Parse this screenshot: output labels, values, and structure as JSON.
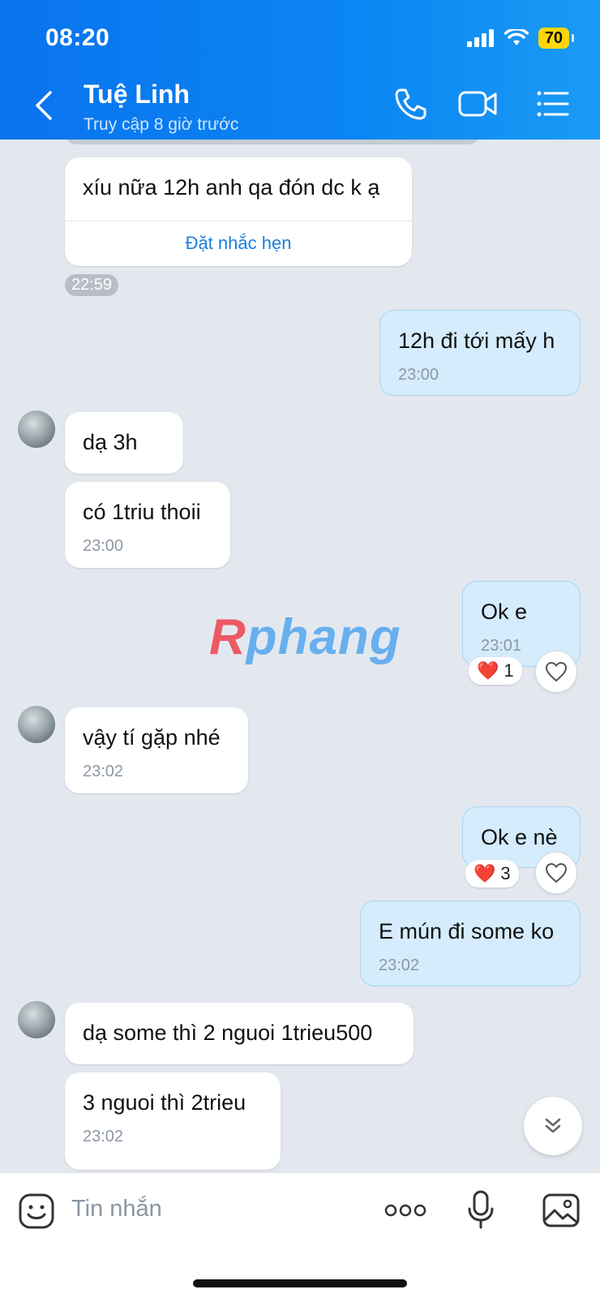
{
  "status_bar": {
    "time": "08:20",
    "battery": "70"
  },
  "header": {
    "contact_name": "Tuệ Linh",
    "contact_status": "Truy cập 8 giờ trước",
    "icons": [
      "back-icon",
      "phone-icon",
      "video-call-icon",
      "menu-icon"
    ]
  },
  "messages": [
    {
      "side": "in",
      "text": "xíu nữa 12h anh qa đón dc k ạ",
      "action": "Đặt nhắc hẹn",
      "time": "22:59"
    },
    {
      "side": "out",
      "text": "12h đi tới mấy h",
      "time": "23:00"
    },
    {
      "side": "in",
      "text": "dạ 3h"
    },
    {
      "side": "in",
      "text": "có 1triu thoii",
      "time": "23:00"
    },
    {
      "side": "out",
      "text": "Ok e",
      "time": "23:01",
      "reaction": {
        "emoji": "❤️",
        "count": "1"
      }
    },
    {
      "side": "in",
      "text": "vậy tí gặp nhé",
      "time": "23:02"
    },
    {
      "side": "out",
      "text": "Ok e nè",
      "reaction": {
        "emoji": "❤️",
        "count": "3"
      }
    },
    {
      "side": "out",
      "text": "E mún đi some ko",
      "time": "23:02"
    },
    {
      "side": "in",
      "text": "dạ some thì 2 nguoi 1trieu500"
    },
    {
      "side": "in",
      "text": "3 nguoi thì 2trieu",
      "time": "23:02"
    }
  ],
  "watermark": {
    "first": "R",
    "rest": "phang"
  },
  "composer": {
    "placeholder": "Tin nhắn"
  },
  "colors": {
    "header": "#0a73ee",
    "outgoing_bubble": "#d4ecfc",
    "link": "#1a7fe0",
    "chat_bg": "#e3e8ef"
  }
}
